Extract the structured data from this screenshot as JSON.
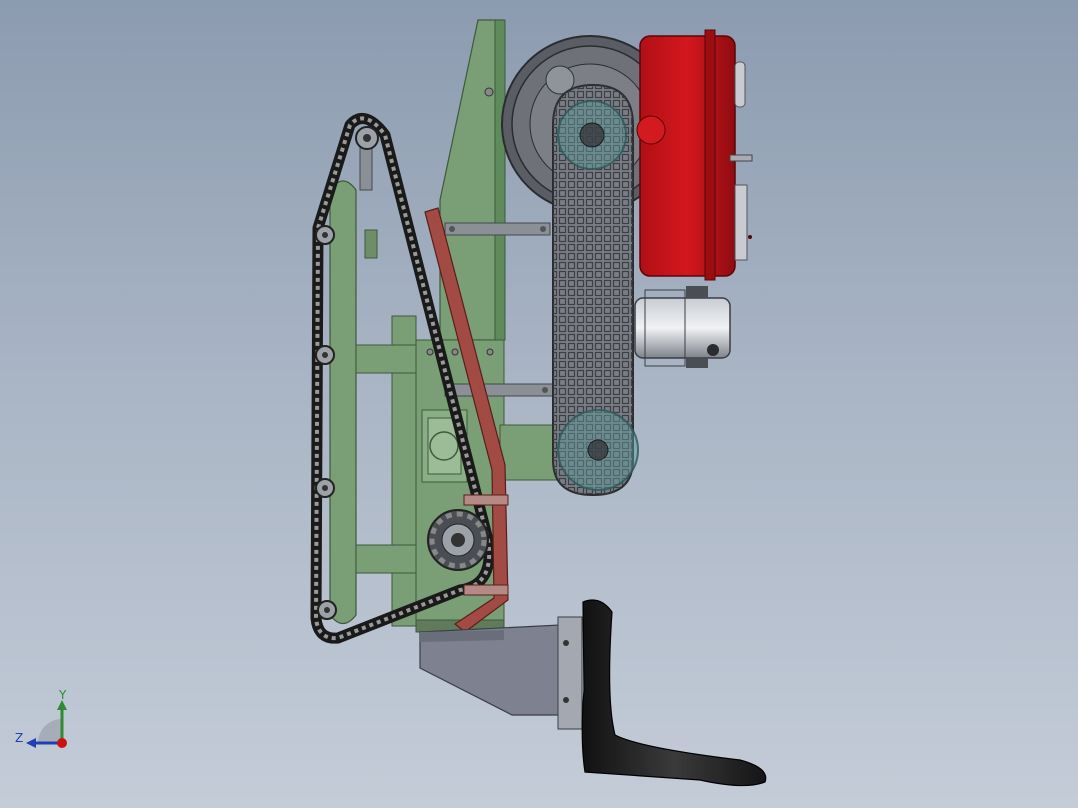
{
  "viewport": {
    "background_top": "#8c9bb0",
    "background_bottom": "#c4ccd8"
  },
  "triad": {
    "y_label": "Y",
    "z_label": "Z",
    "y_color": "#2e8b2e",
    "z_color": "#1f3fb5",
    "x_color": "#cc1111"
  },
  "colors": {
    "frame_green": "#7a9e76",
    "frame_green_dark": "#4f6f4c",
    "engine_red": "#c4141a",
    "guard_grey": "#6e7278",
    "chain_dark": "#2a2a2a",
    "rail_red": "#a24a44",
    "hopper_grey": "#7e8290",
    "shoe_black": "#1c1c1c",
    "motor_grey": "#9a9ea4"
  },
  "model": {
    "description_icons": [
      "chain-track",
      "engine",
      "belt-guard",
      "sprocket",
      "electric-motor",
      "plough-shoe"
    ]
  }
}
